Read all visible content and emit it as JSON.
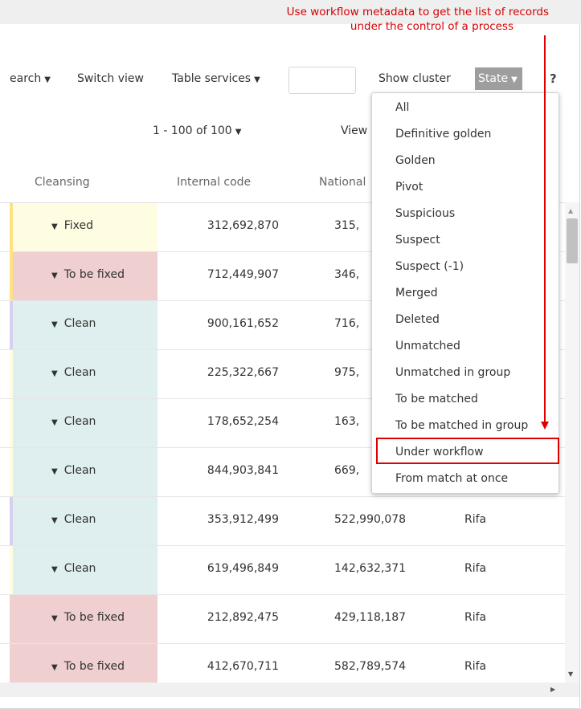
{
  "annotation": {
    "line1": "Use workflow metadata to get the list of records",
    "line2": "under the control of a process",
    "color": "#e00000"
  },
  "toolbar": {
    "search_label": "earch",
    "switch_view_label": "Switch view",
    "table_services_label": "Table services",
    "filter_input_value": "",
    "show_cluster_label": "Show cluster",
    "state_label": "State",
    "help_label": "?"
  },
  "pager": {
    "range_label": "1 - 100 of 100",
    "view_label": "View"
  },
  "columns": {
    "cleansing": "Cleansing",
    "internal_code": "Internal code",
    "national": "National"
  },
  "rows": [
    {
      "cleansing": "Fixed",
      "internal_code": "312,692,870",
      "national": "315,",
      "name": "",
      "bg": "#fffde1",
      "edge": "#ffe082"
    },
    {
      "cleansing": "To be fixed",
      "internal_code": "712,449,907",
      "national": "346,",
      "name": "",
      "bg": "#efcfd0",
      "edge": "#ffe082"
    },
    {
      "cleansing": "Clean",
      "internal_code": "900,161,652",
      "national": "716,",
      "name": "",
      "bg": "#dfeeee",
      "edge": "#d6d0ef"
    },
    {
      "cleansing": "Clean",
      "internal_code": "225,322,667",
      "national": "975,",
      "name": "",
      "bg": "#dfeeee",
      "edge": "#fffde1"
    },
    {
      "cleansing": "Clean",
      "internal_code": "178,652,254",
      "national": "163,",
      "name": "",
      "bg": "#dfeeee",
      "edge": "#fffde1"
    },
    {
      "cleansing": "Clean",
      "internal_code": "844,903,841",
      "national": "669,",
      "name": "",
      "bg": "#dfeeee",
      "edge": "#fffde1"
    },
    {
      "cleansing": "Clean",
      "internal_code": "353,912,499",
      "national": "522,990,078",
      "name": "Rifa",
      "bg": "#dfeeee",
      "edge": "#d6d0ef"
    },
    {
      "cleansing": "Clean",
      "internal_code": "619,496,849",
      "national": "142,632,371",
      "name": "Rifa",
      "bg": "#dfeeee",
      "edge": "#fffde1"
    },
    {
      "cleansing": "To be fixed",
      "internal_code": "212,892,475",
      "national": "429,118,187",
      "name": "Rifa",
      "bg": "#efcfd0",
      "edge": "#efcfd0"
    },
    {
      "cleansing": "To be fixed",
      "internal_code": "412,670,711",
      "national": "582,789,574",
      "name": "Rifa",
      "bg": "#efcfd0",
      "edge": "#efcfd0"
    }
  ],
  "state_menu": {
    "items": [
      "All",
      "Definitive golden",
      "Golden",
      "Pivot",
      "Suspicious",
      "Suspect",
      "Suspect (-1)",
      "Merged",
      "Deleted",
      "Unmatched",
      "Unmatched in group",
      "To be matched",
      "To be matched in group",
      "Under workflow",
      "From match at once"
    ],
    "highlighted_item": "Under workflow"
  }
}
